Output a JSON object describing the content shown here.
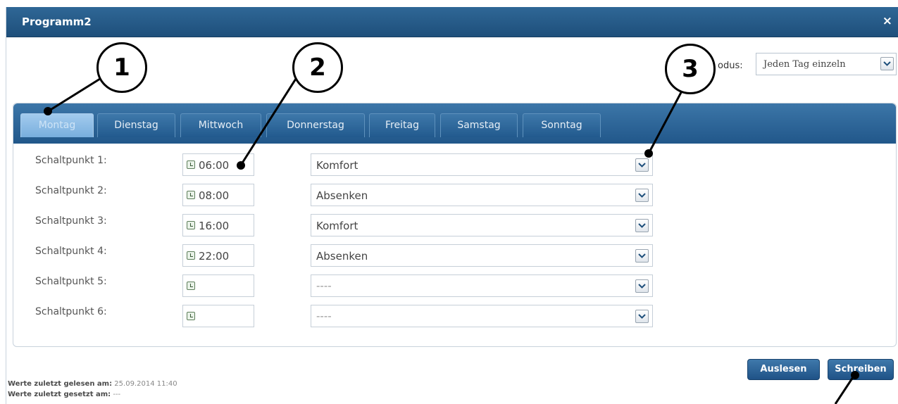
{
  "window": {
    "title": "Programm2",
    "close_icon": "×"
  },
  "mode": {
    "label": "odus:",
    "value": "Jeden Tag einzeln"
  },
  "tabs": [
    "Montag",
    "Dienstag",
    "Mittwoch",
    "Donnerstag",
    "Freitag",
    "Samstag",
    "Sonntag"
  ],
  "active_tab": "Montag",
  "rows": [
    {
      "label": "Schaltpunkt 1:",
      "time": "06:00",
      "mode": "Komfort"
    },
    {
      "label": "Schaltpunkt 2:",
      "time": "08:00",
      "mode": "Absenken"
    },
    {
      "label": "Schaltpunkt 3:",
      "time": "16:00",
      "mode": "Komfort"
    },
    {
      "label": "Schaltpunkt 4:",
      "time": "22:00",
      "mode": "Absenken"
    },
    {
      "label": "Schaltpunkt 5:",
      "time": "",
      "mode": "----"
    },
    {
      "label": "Schaltpunkt 6:",
      "time": "",
      "mode": "----"
    }
  ],
  "buttons": {
    "read": "Auslesen",
    "write": "Schreiben"
  },
  "footer": {
    "read_label": "Werte zuletzt gelesen am:",
    "read_value": "25.09.2014 11:40",
    "set_label": "Werte zuletzt gesetzt am:",
    "set_value": "---"
  },
  "callouts": [
    "1",
    "2",
    "3"
  ]
}
